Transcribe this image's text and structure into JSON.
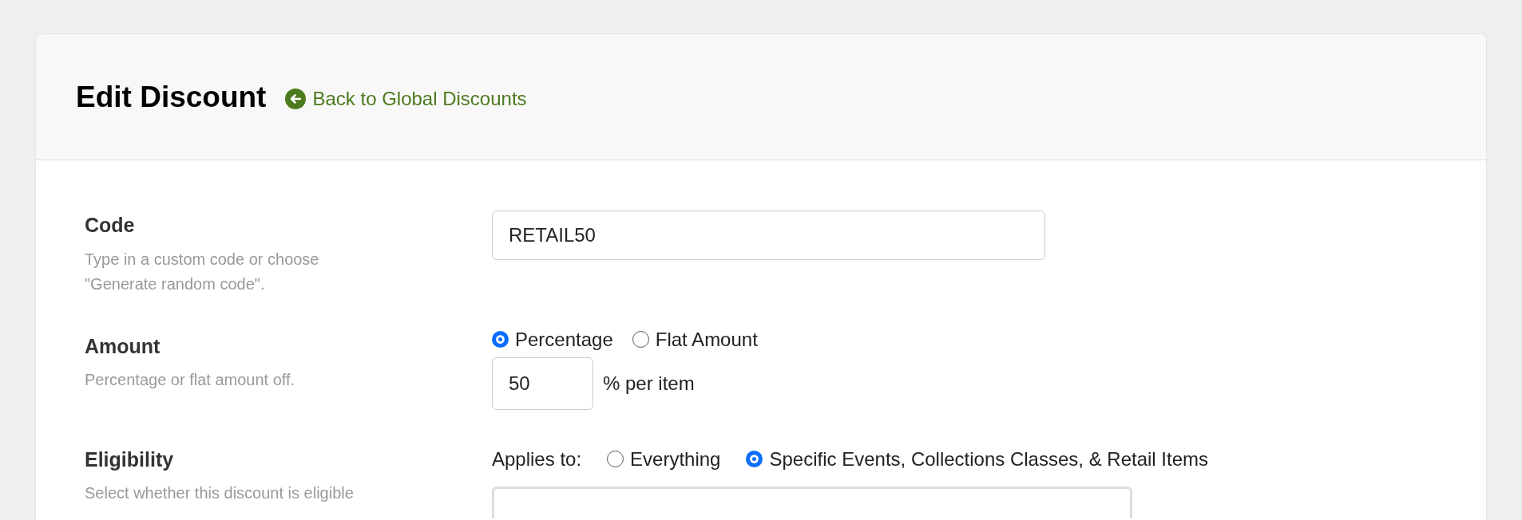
{
  "page": {
    "title": "Edit Discount",
    "back_link": "Back to Global Discounts"
  },
  "fields": [
    {
      "kind": "text",
      "label": "Code",
      "description": "Type in a custom code or choose \"Generate random code\".",
      "value": "RETAIL50"
    },
    {
      "kind": "amount",
      "label": "Amount",
      "description": "Percentage or flat amount off.",
      "options": [
        {
          "label": "Percentage",
          "selected": true
        },
        {
          "label": "Flat Amount",
          "selected": false
        }
      ],
      "value": "50",
      "unit": "% per item"
    },
    {
      "kind": "eligibility",
      "label": "Eligibility",
      "description": "Select whether this discount is eligible",
      "prompt": "Applies to:",
      "options": [
        {
          "label": "Everything",
          "selected": false
        },
        {
          "label": "Specific Events, Collections Classes, & Retail Items",
          "selected": true
        }
      ]
    }
  ]
}
